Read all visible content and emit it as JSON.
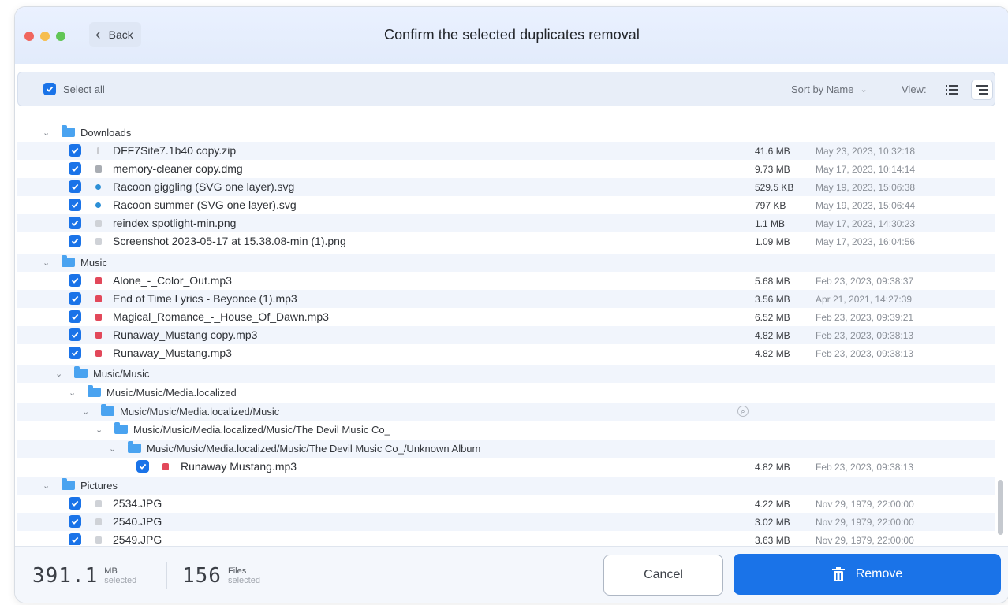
{
  "window": {
    "title": "Confirm the selected duplicates removal",
    "back_label": "Back"
  },
  "toolbar": {
    "select_all_label": "Select all",
    "sort_label": "Sort by Name",
    "view_label": "View:"
  },
  "groups": {
    "downloads": {
      "label": "Downloads",
      "files": [
        {
          "name": "DFF7Site7.1b40 copy.zip",
          "size": "41.6 MB",
          "date": "May 23, 2023, 10:32:18",
          "icon": "zip-icon"
        },
        {
          "name": "memory-cleaner copy.dmg",
          "size": "9.73 MB",
          "date": "May 17, 2023, 10:14:14",
          "icon": "dmg-icon"
        },
        {
          "name": "Racoon giggling (SVG one layer).svg",
          "size": "529.5 KB",
          "date": "May 19, 2023, 15:06:38",
          "icon": "svg-icon"
        },
        {
          "name": "Racoon summer (SVG one layer).svg",
          "size": "797 KB",
          "date": "May 19, 2023, 15:06:44",
          "icon": "svg-icon"
        },
        {
          "name": "reindex spotlight-min.png",
          "size": "1.1 MB",
          "date": "May 17, 2023, 14:30:23",
          "icon": "image-icon"
        },
        {
          "name": "Screenshot 2023-05-17 at 15.38.08-min (1).png",
          "size": "1.09 MB",
          "date": "May 17, 2023, 16:04:56",
          "icon": "image-icon"
        }
      ]
    },
    "music": {
      "label": "Music",
      "files": [
        {
          "name": "Alone_-_Color_Out.mp3",
          "size": "5.68 MB",
          "date": "Feb 23, 2023, 09:38:37",
          "icon": "audio-icon"
        },
        {
          "name": "End of Time Lyrics - Beyonce (1).mp3",
          "size": "3.56 MB",
          "date": "Apr 21, 2021, 14:27:39",
          "icon": "audio-icon"
        },
        {
          "name": "Magical_Romance_-_House_Of_Dawn.mp3",
          "size": "6.52 MB",
          "date": "Feb 23, 2023, 09:39:21",
          "icon": "audio-icon"
        },
        {
          "name": "Runaway_Mustang copy.mp3",
          "size": "4.82 MB",
          "date": "Feb 23, 2023, 09:38:13",
          "icon": "audio-icon"
        },
        {
          "name": "Runaway_Mustang.mp3",
          "size": "4.82 MB",
          "date": "Feb 23, 2023, 09:38:13",
          "icon": "audio-icon"
        }
      ]
    },
    "subfolders": [
      {
        "label": "Music/Music"
      },
      {
        "label": "Music/Music/Media.localized"
      },
      {
        "label": "Music/Music/Media.localized/Music"
      },
      {
        "label": "Music/Music/Media.localized/Music/The Devil Music Co_"
      },
      {
        "label": "Music/Music/Media.localized/Music/The Devil Music Co_/Unknown Album"
      }
    ],
    "nested_file": {
      "name": "Runaway Mustang.mp3",
      "size": "4.82 MB",
      "date": "Feb 23, 2023, 09:38:13",
      "icon": "audio-icon"
    },
    "pictures": {
      "label": "Pictures",
      "files": [
        {
          "name": "2534.JPG",
          "size": "4.22 MB",
          "date": "Nov 29, 1979, 22:00:00",
          "icon": "image-icon"
        },
        {
          "name": "2540.JPG",
          "size": "3.02 MB",
          "date": "Nov 29, 1979, 22:00:00",
          "icon": "image-icon"
        },
        {
          "name": "2549.JPG",
          "size": "3.63 MB",
          "date": "Nov 29, 1979, 22:00:00",
          "icon": "image-icon"
        }
      ]
    }
  },
  "footer": {
    "size_value": "391.1",
    "size_unit": "MB",
    "size_caption": "selected",
    "files_value": "156",
    "files_unit": "Files",
    "files_caption": "selected",
    "cancel_label": "Cancel",
    "remove_label": "Remove"
  },
  "colors": {
    "accent": "#1a73e8",
    "folder": "#4aa3f0",
    "audio": "#e2485a",
    "row_alt": "#f1f5fc",
    "titlebar": "#e6eefb"
  },
  "scrollbar": {
    "visible": true
  }
}
